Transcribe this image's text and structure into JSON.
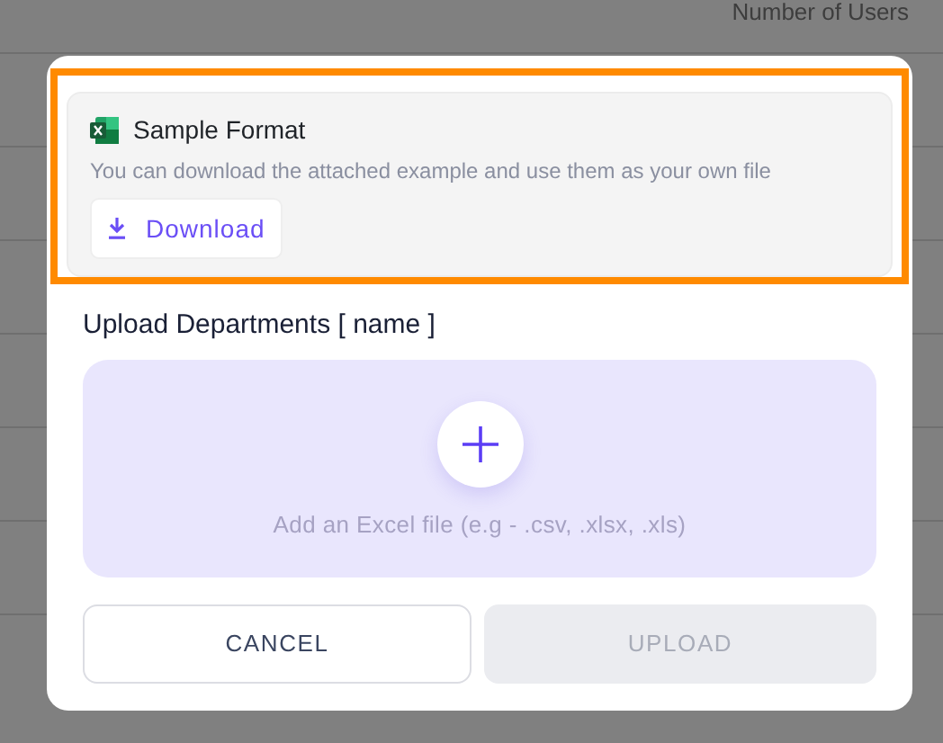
{
  "table": {
    "columns": [
      "Number of Users"
    ]
  },
  "dialog": {
    "sample": {
      "title": "Sample Format",
      "description": "You can download the attached example and use them as your own file",
      "download_button": "Download",
      "highlighted": true
    },
    "upload_label": "Upload Departments [ name ]",
    "dropzone": {
      "hint": "Add an Excel file (e.g - .csv, .xlsx, .xls)"
    },
    "buttons": [
      {
        "label": "CANCEL",
        "kind": "secondary",
        "disabled": false
      },
      {
        "label": "UPLOAD",
        "kind": "primary",
        "disabled": true
      }
    ]
  }
}
